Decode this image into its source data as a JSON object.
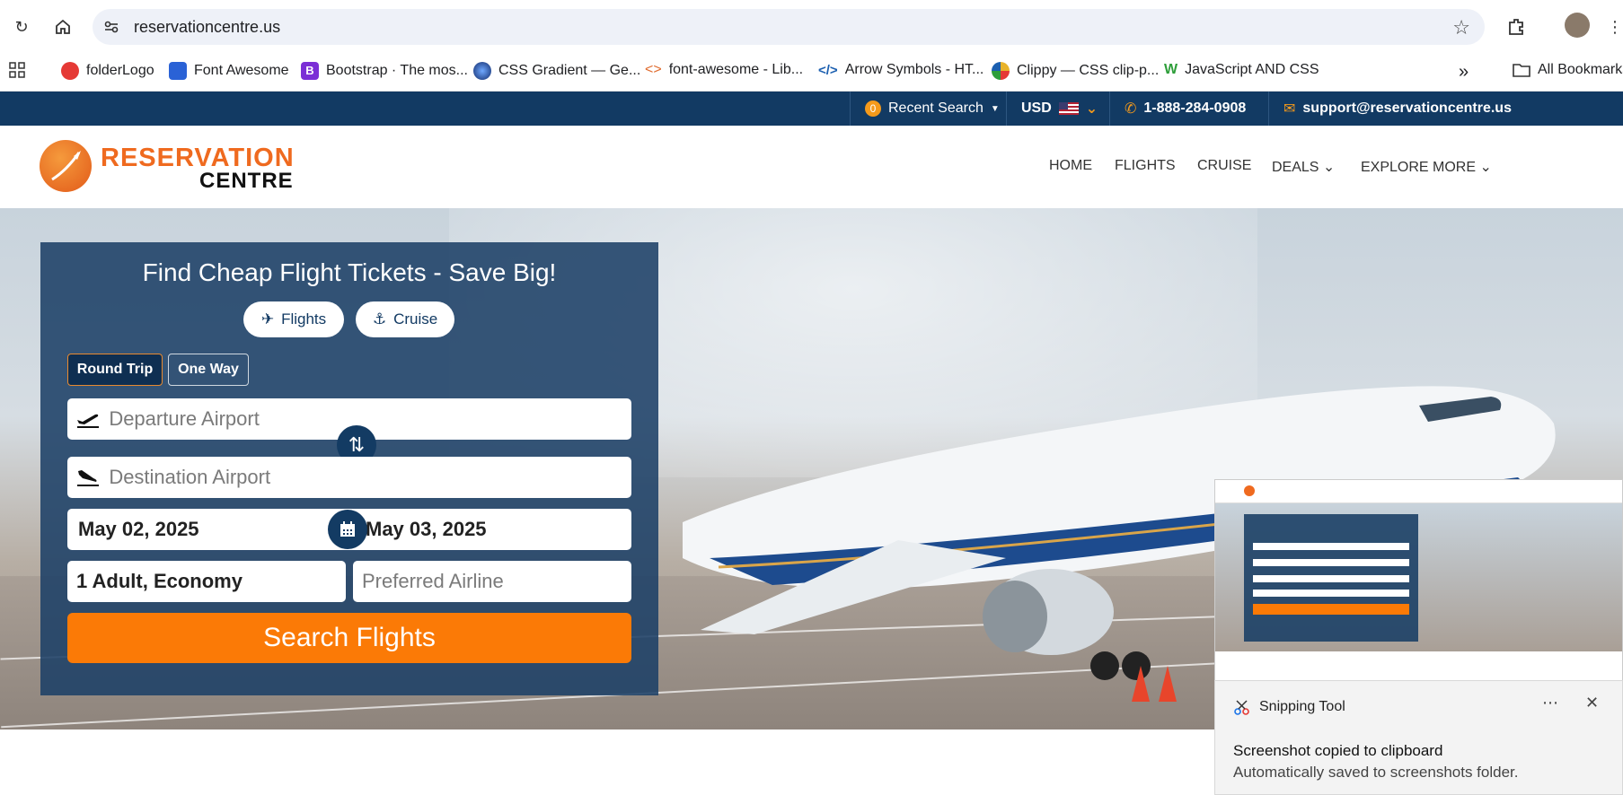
{
  "browser": {
    "url": "reservationcentre.us",
    "bookmarks": [
      {
        "label": "folderLogo",
        "color": "#e53935"
      },
      {
        "label": "Font Awesome",
        "color": "#2a62d6"
      },
      {
        "label": "Bootstrap · The mos...",
        "color": "#7b2fd6"
      },
      {
        "label": "CSS Gradient — Ge...",
        "color": "#1f4fa8"
      },
      {
        "label": "font-awesome - Lib...",
        "color": "#e06b2e"
      },
      {
        "label": "Arrow Symbols - HT...",
        "color": "#1b5fb0"
      },
      {
        "label": "Clippy — CSS clip-p...",
        "color": "#e8b32a"
      },
      {
        "label": "JavaScript AND CSS",
        "color": "#2e9e3a"
      }
    ],
    "all_bookmarks_label": "All Bookmarks"
  },
  "topbar": {
    "recent_count": "0",
    "recent_label": "Recent Search",
    "currency": "USD",
    "phone": "1-888-284-0908",
    "email": "support@reservationcentre.us"
  },
  "logo": {
    "line1": "RESERVATION",
    "line2": "CENTRE"
  },
  "nav": {
    "home": "HOME",
    "flights": "FLIGHTS",
    "cruise": "CRUISE",
    "deals": "DEALS",
    "explore": "EXPLORE MORE"
  },
  "search": {
    "title": "Find Cheap Flight Tickets - Save Big!",
    "tab_flights": "Flights",
    "tab_cruise": "Cruise",
    "round_trip": "Round Trip",
    "one_way": "One Way",
    "departure_placeholder": "Departure Airport",
    "destination_placeholder": "Destination Airport",
    "depart_date": "May 02, 2025",
    "return_date": "May 03, 2025",
    "travellers": "1 Adult, Economy",
    "airline_placeholder": "Preferred Airline",
    "submit": "Search Flights"
  },
  "toast": {
    "app": "Snipping Tool",
    "message": "Screenshot copied to clipboard",
    "sub": "Automatically saved to screenshots folder."
  }
}
